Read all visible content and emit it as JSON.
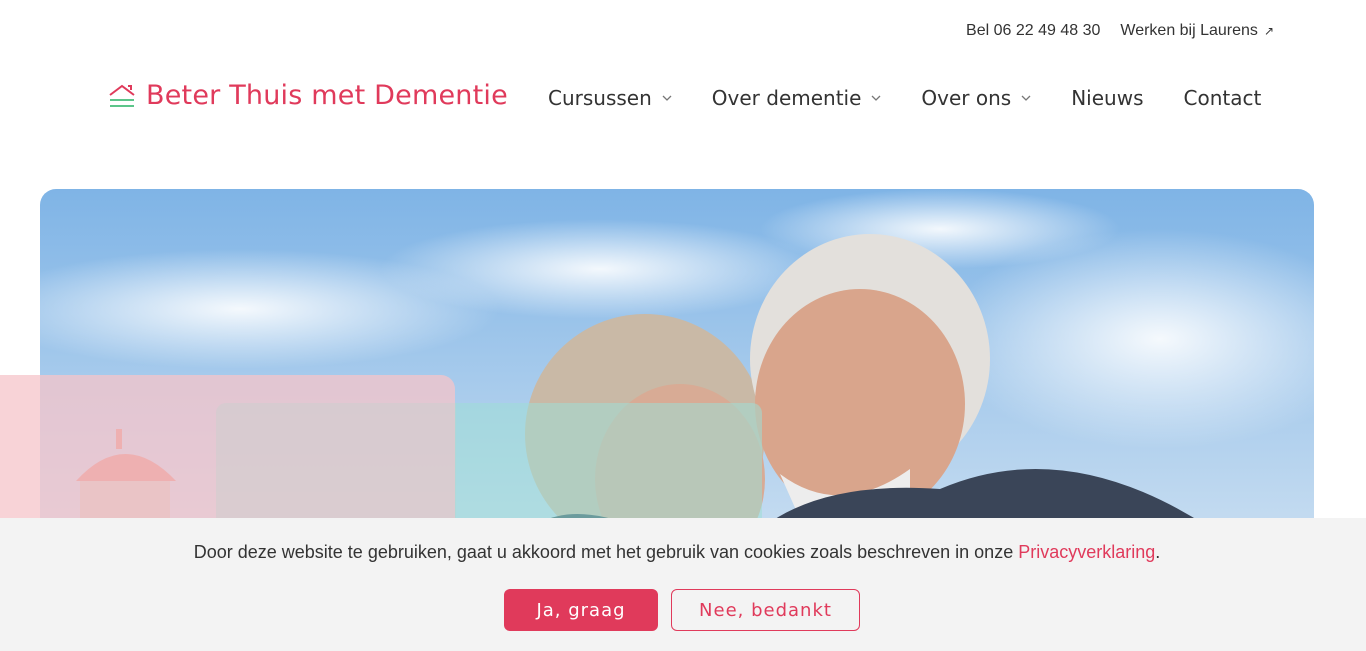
{
  "topbar": {
    "phone": "Bel 06 22 49 48 30",
    "jobs": "Werken bij Laurens",
    "jobs_icon": "external-arrow-icon"
  },
  "header": {
    "logo_text": "Beter Thuis met Dementie",
    "logo_icon": "house-roof-icon",
    "nav": [
      {
        "label": "Cursussen",
        "has_dropdown": true
      },
      {
        "label": "Over dementie",
        "has_dropdown": true
      },
      {
        "label": "Over ons",
        "has_dropdown": true
      },
      {
        "label": "Nieuws",
        "has_dropdown": false
      },
      {
        "label": "Contact",
        "has_dropdown": false
      }
    ]
  },
  "hero": {
    "image": "two-smiling-seniors-photo"
  },
  "cookie": {
    "text": "Door deze website te gebruiken, gaat u akkoord met het gebruik van cookies zoals beschreven in onze ",
    "link": "Privacyverklaring",
    "suffix": ".",
    "accept_label": "Ja, graag",
    "decline_label": "Nee, bedankt"
  },
  "colors": {
    "brand": "#e03a5b",
    "accent_green": "#5cc58a",
    "banner_bg": "#f3f3f3"
  }
}
